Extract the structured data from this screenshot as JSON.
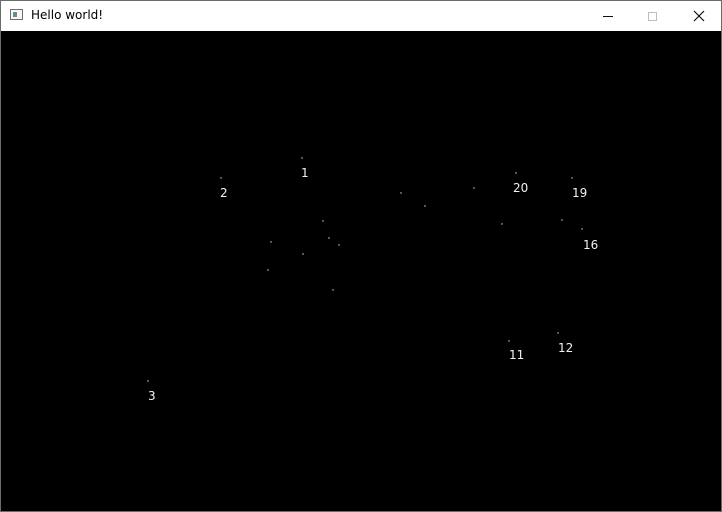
{
  "window": {
    "title": "Hello world!"
  },
  "canvas": {
    "background": "#000000",
    "labels": [
      "1",
      "2",
      "3",
      "11",
      "12",
      "16",
      "19",
      "20"
    ]
  }
}
